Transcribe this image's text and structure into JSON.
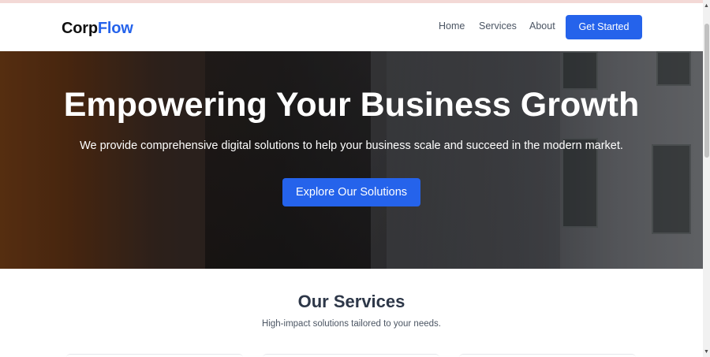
{
  "header": {
    "logo_primary": "Corp",
    "logo_accent": "Flow",
    "nav": [
      "Home",
      "Services",
      "About"
    ],
    "cta_label": "Get Started"
  },
  "hero": {
    "title": "Empowering Your Business Growth",
    "subtitle": "We provide comprehensive digital solutions to help your business scale and succeed in the modern market.",
    "button_label": "Explore Our Solutions"
  },
  "services": {
    "title": "Our Services",
    "subtitle": "High-impact solutions tailored to your needs."
  },
  "colors": {
    "accent": "#2563eb",
    "heading": "#2d3748",
    "text_muted": "#4b5563"
  },
  "icons": {
    "scroll_up": "triangle-up-icon",
    "scroll_down": "triangle-down-icon"
  }
}
